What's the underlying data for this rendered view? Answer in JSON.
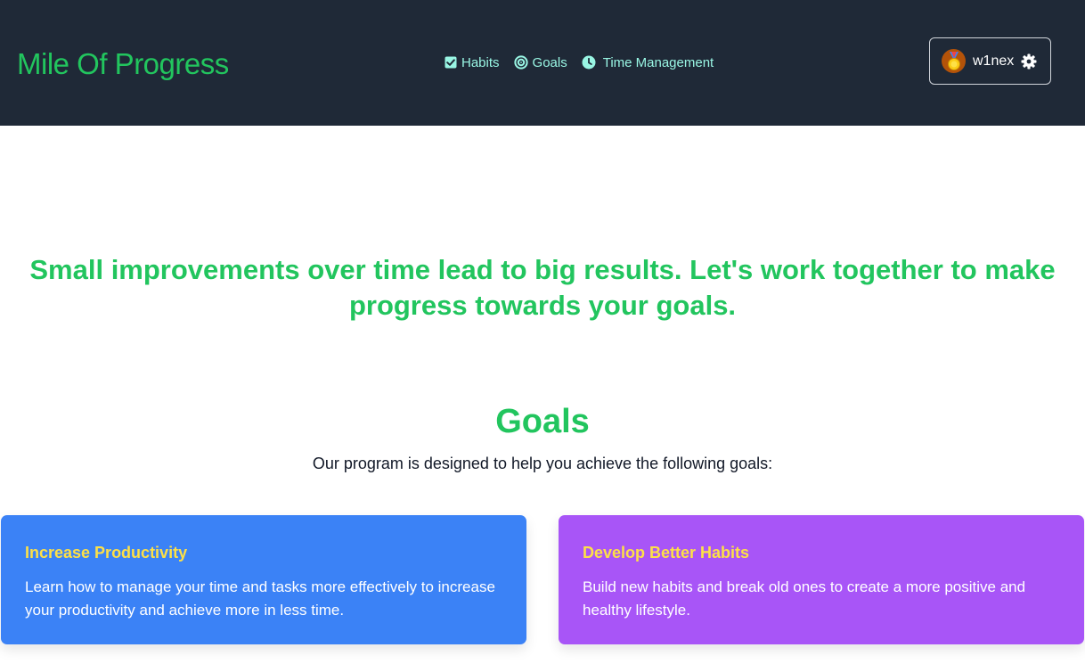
{
  "header": {
    "brand": "Mile Of Progress",
    "nav": [
      {
        "label": "Habits",
        "icon": "checkbox-icon"
      },
      {
        "label": "Goals",
        "icon": "target-icon"
      },
      {
        "label": "Time Management",
        "icon": "clock-icon"
      }
    ],
    "user": {
      "name": "w1nex",
      "avatar_icon": "medal-icon",
      "settings_icon": "gear-icon"
    }
  },
  "hero": {
    "text": "Small improvements over time lead to big results. Let's work together to make progress towards your goals."
  },
  "goals": {
    "title": "Goals",
    "subtitle": "Our program is designed to help you achieve the following goals:",
    "cards": [
      {
        "title": "Increase Productivity",
        "text": "Learn how to manage your time and tasks more effectively to increase your productivity and achieve more in less time."
      },
      {
        "title": "Develop Better Habits",
        "text": "Build new habits and break old ones to create a more positive and healthy lifestyle."
      }
    ]
  },
  "colors": {
    "header_bg": "#1f2937",
    "brand_green": "#22c55e",
    "nav_teal": "#99f6e4",
    "card_blue": "#3b82f6",
    "card_purple": "#a855f7",
    "card_title_yellow": "#fde047"
  }
}
